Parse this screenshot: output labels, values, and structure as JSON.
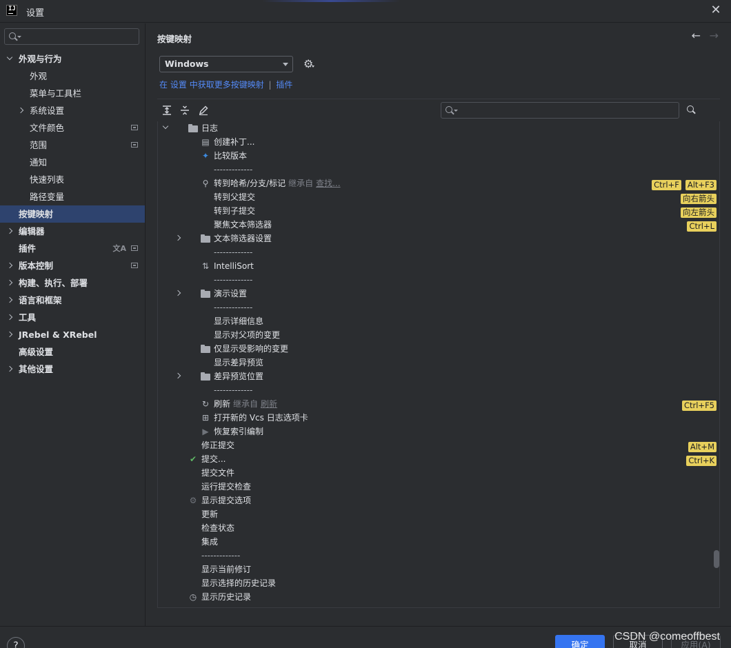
{
  "window": {
    "title": "设置",
    "logo": "IJ"
  },
  "sidebar": {
    "search_placeholder": "",
    "items": [
      {
        "label": "外观与行为",
        "level": 0,
        "chevron": "down"
      },
      {
        "label": "外观",
        "level": 1
      },
      {
        "label": "菜单与工具栏",
        "level": 1
      },
      {
        "label": "系统设置",
        "level": 1,
        "chevron": "right"
      },
      {
        "label": "文件颜色",
        "level": 1,
        "badge": true
      },
      {
        "label": "范围",
        "level": 1,
        "badge": true
      },
      {
        "label": "通知",
        "level": 1
      },
      {
        "label": "快速列表",
        "level": 1
      },
      {
        "label": "路径变量",
        "level": 1
      },
      {
        "label": "按键映射",
        "level": 0,
        "selected": true
      },
      {
        "label": "编辑器",
        "level": 0,
        "chevron": "right"
      },
      {
        "label": "插件",
        "level": 0,
        "badge": true,
        "translate": true
      },
      {
        "label": "版本控制",
        "level": 0,
        "chevron": "right",
        "badge": true
      },
      {
        "label": "构建、执行、部署",
        "level": 0,
        "chevron": "right"
      },
      {
        "label": "语言和框架",
        "level": 0,
        "chevron": "right"
      },
      {
        "label": "工具",
        "level": 0,
        "chevron": "right"
      },
      {
        "label": "JRebel & XRebel",
        "level": 0,
        "chevron": "right"
      },
      {
        "label": "高级设置",
        "level": 0
      },
      {
        "label": "其他设置",
        "level": 0,
        "chevron": "right"
      }
    ]
  },
  "main": {
    "title": "按键映射",
    "keymap_selected": "Windows",
    "link_line": {
      "prefix": "在",
      "settings": "设置",
      "middle": "中获取更多按键映射",
      "sep": "|",
      "plugins": "插件"
    },
    "filter_placeholder": "",
    "actions": [
      {
        "indent": 1,
        "chevron": "down",
        "icon": "folder-icon",
        "label": "日志"
      },
      {
        "indent": 2,
        "icon": "create-patch-icon",
        "label": "创建补丁..."
      },
      {
        "indent": 2,
        "icon": "compare-icon",
        "label": "比较版本"
      },
      {
        "indent": 2,
        "separator": true,
        "label": "-------------"
      },
      {
        "indent": 2,
        "icon": "search-icon",
        "label": "转到哈希/分支/标记",
        "muted": "继承自",
        "link": "查找...",
        "shortcuts": [
          "Ctrl+F",
          "Alt+F3"
        ]
      },
      {
        "indent": 2,
        "label": "转到父提交",
        "shortcuts": [
          "向右箭头"
        ]
      },
      {
        "indent": 2,
        "label": "转到子提交",
        "shortcuts": [
          "向左箭头"
        ]
      },
      {
        "indent": 2,
        "label": "聚焦文本筛选器",
        "shortcuts": [
          "Ctrl+L"
        ]
      },
      {
        "indent": 2,
        "chevron": "right",
        "icon": "folder-icon",
        "label": "文本筛选器设置"
      },
      {
        "indent": 2,
        "separator": true,
        "label": "-------------"
      },
      {
        "indent": 2,
        "icon": "sort-icon",
        "label": "IntelliSort"
      },
      {
        "indent": 2,
        "separator": true,
        "label": "-------------"
      },
      {
        "indent": 2,
        "chevron": "right",
        "icon": "folder-icon",
        "label": "演示设置"
      },
      {
        "indent": 2,
        "separator": true,
        "label": "-------------"
      },
      {
        "indent": 2,
        "label": "显示详细信息"
      },
      {
        "indent": 2,
        "label": "显示对父项的变更"
      },
      {
        "indent": 2,
        "icon": "folder-icon",
        "label": "仅显示受影响的变更"
      },
      {
        "indent": 2,
        "label": "显示差异预览"
      },
      {
        "indent": 2,
        "chevron": "right",
        "icon": "folder-icon",
        "label": "差异预览位置"
      },
      {
        "indent": 2,
        "separator": true,
        "label": "-------------"
      },
      {
        "indent": 2,
        "icon": "refresh-icon",
        "label": "刷新",
        "muted": "继承自",
        "link": "刷新",
        "shortcuts": [
          "Ctrl+F5"
        ]
      },
      {
        "indent": 2,
        "icon": "new-tab-icon",
        "label": "打开新的 Vcs 日志选项卡"
      },
      {
        "indent": 2,
        "icon": "play-icon",
        "label": "恢复索引编制"
      },
      {
        "indent": 1,
        "label": "修正提交",
        "shortcuts": [
          "Alt+M"
        ]
      },
      {
        "indent": 1,
        "icon": "check-icon",
        "label": "提交...",
        "shortcuts": [
          "Ctrl+K"
        ]
      },
      {
        "indent": 1,
        "label": "提交文件"
      },
      {
        "indent": 1,
        "label": "运行提交检查"
      },
      {
        "indent": 1,
        "icon": "gear-icon",
        "label": "显示提交选项"
      },
      {
        "indent": 1,
        "label": "更新"
      },
      {
        "indent": 1,
        "label": "检查状态"
      },
      {
        "indent": 1,
        "label": "集成"
      },
      {
        "indent": 1,
        "separator": true,
        "label": "-------------"
      },
      {
        "indent": 1,
        "label": "显示当前修订"
      },
      {
        "indent": 1,
        "label": "显示选择的历史记录"
      },
      {
        "indent": 1,
        "icon": "history-icon",
        "label": "显示历史记录"
      }
    ]
  },
  "footer": {
    "help": "?",
    "ok": "确定",
    "cancel": "取消",
    "apply": "应用(A)",
    "watermark": "CSDN @comeoffbest"
  },
  "colors": {
    "background": "#2b2d30",
    "selection": "#2e436e",
    "link": "#548af7",
    "shortcut_badge": "#e8d05c",
    "primary_button": "#3574f0"
  }
}
